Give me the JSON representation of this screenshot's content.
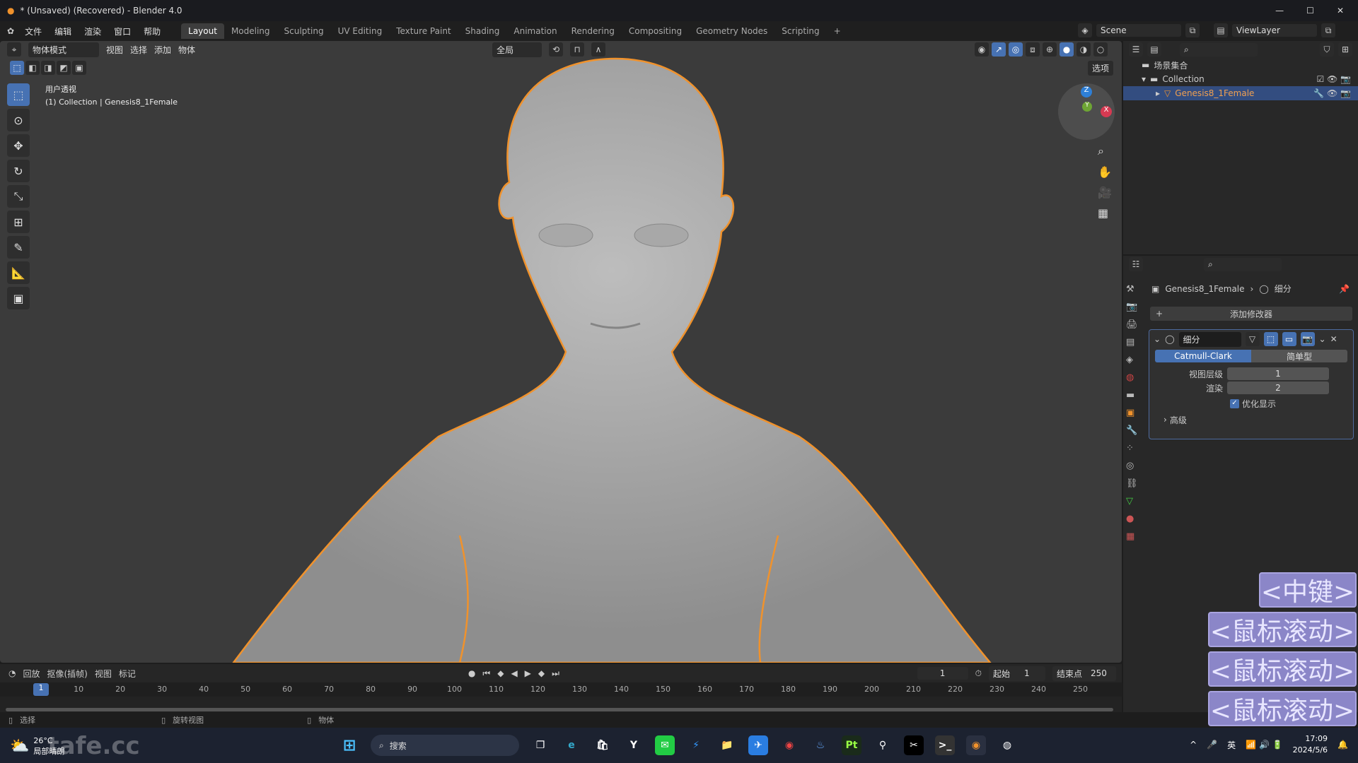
{
  "window": {
    "title": "* (Unsaved) (Recovered) - Blender 4.0"
  },
  "menu": [
    "文件",
    "编辑",
    "渲染",
    "窗口",
    "帮助"
  ],
  "workspaces": [
    "Layout",
    "Modeling",
    "Sculpting",
    "UV Editing",
    "Texture Paint",
    "Shading",
    "Animation",
    "Rendering",
    "Compositing",
    "Geometry Nodes",
    "Scripting",
    "+"
  ],
  "scene": {
    "label": "Scene",
    "viewlayer": "ViewLayer"
  },
  "viewport": {
    "mode": "物体模式",
    "menus": [
      "视图",
      "选择",
      "添加",
      "物体"
    ],
    "transform": "全局",
    "options": "选项",
    "overlay_line1": "用户透视",
    "overlay_line2": "(1) Collection | Genesis8_1Female",
    "accent": "#4772b3",
    "outline_color": "#f0922c"
  },
  "outliner": {
    "root": "场景集合",
    "collection": "Collection",
    "object": "Genesis8_1Female"
  },
  "properties": {
    "breadcrumb_object": "Genesis8_1Female",
    "breadcrumb_modifier": "细分",
    "add_modifier": "添加修改器",
    "modifier_name": "细分",
    "catmull": "Catmull-Clark",
    "simple": "简单型",
    "levels_label": "视图层级",
    "levels_value": "1",
    "render_label": "渲染",
    "render_value": "2",
    "optimal_label": "优化显示",
    "optimal_checked": true,
    "advanced": "高级"
  },
  "timeline": {
    "menus": [
      "回放",
      "抠像(插帧)",
      "视图",
      "标记"
    ],
    "current_frame": "1",
    "start_label": "起始",
    "start": "1",
    "end_label": "结束点",
    "end": "250",
    "ticks": [
      "10",
      "20",
      "30",
      "40",
      "50",
      "60",
      "70",
      "80",
      "90",
      "100",
      "110",
      "120",
      "130",
      "140",
      "150",
      "160",
      "170",
      "180",
      "190",
      "200",
      "210",
      "220",
      "230",
      "240",
      "250"
    ],
    "playhead": "1"
  },
  "status": {
    "select": "选择",
    "rotate": "旋转视图",
    "object": "物体"
  },
  "keys": [
    "<中键>",
    "<鼠标滚动>",
    "<鼠标滚动>",
    "<鼠标滚动>"
  ],
  "taskbar": {
    "weather_temp": "26°C",
    "weather_desc": "局部晴朗",
    "search": "搜索",
    "ime": "英",
    "time": "17:09",
    "date": "2024/5/6",
    "watermark": "tafe.cc"
  }
}
